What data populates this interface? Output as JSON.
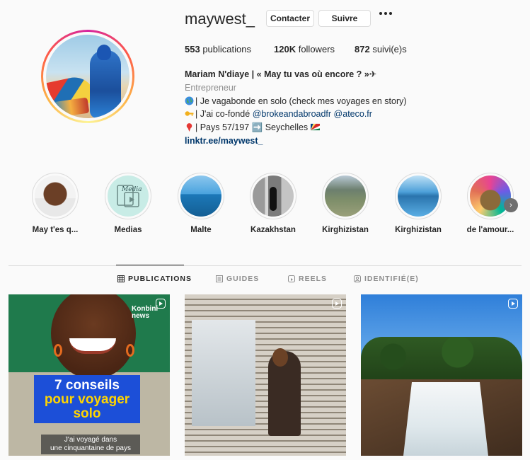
{
  "profile": {
    "username": "maywest_",
    "contact_label": "Contacter",
    "follow_label": "Suivre",
    "stats": {
      "posts_count": "553",
      "posts_label": "publications",
      "followers_count": "120K",
      "followers_label": "followers",
      "following_count": "872",
      "following_label": "suivi(e)s"
    },
    "bio": {
      "name": "Mariam N'diaye | « May tu vas où encore ? »✈",
      "category": "Entrepreneur",
      "line1": "| Je vagabonde en solo (check mes voyages en story)",
      "line2_prefix": "| J'ai co-fondé ",
      "mention1": "@brokeandabroadfr",
      "mention2": "@ateco.fr",
      "line3": "| Pays 57/197 ➡️ Seychelles",
      "link": "linktr.ee/maywest_"
    }
  },
  "highlights": [
    {
      "label": "May t'es q..."
    },
    {
      "label": "Medias"
    },
    {
      "label": "Malte"
    },
    {
      "label": "Kazakhstan"
    },
    {
      "label": "Kirghizistan"
    },
    {
      "label": "Kirghizistan"
    },
    {
      "label": "de l'amour..."
    }
  ],
  "tabs": {
    "publications": "PUBLICATIONS",
    "guides": "GUIDES",
    "reels": "REELS",
    "tagged": "IDENTIFIÉ(E)"
  },
  "posts": {
    "p1_brand_1": "Konbini",
    "p1_brand_2": "news",
    "p1_title_1": "7 conseils",
    "p1_title_2": "pour voyager",
    "p1_title_3": "solo",
    "p1_caption_1": "J'ai voyagé dans",
    "p1_caption_2": "une cinquantaine de pays"
  },
  "colors": {
    "link": "#00376b",
    "muted": "#8e8e8e",
    "border": "#dbdbdb"
  }
}
